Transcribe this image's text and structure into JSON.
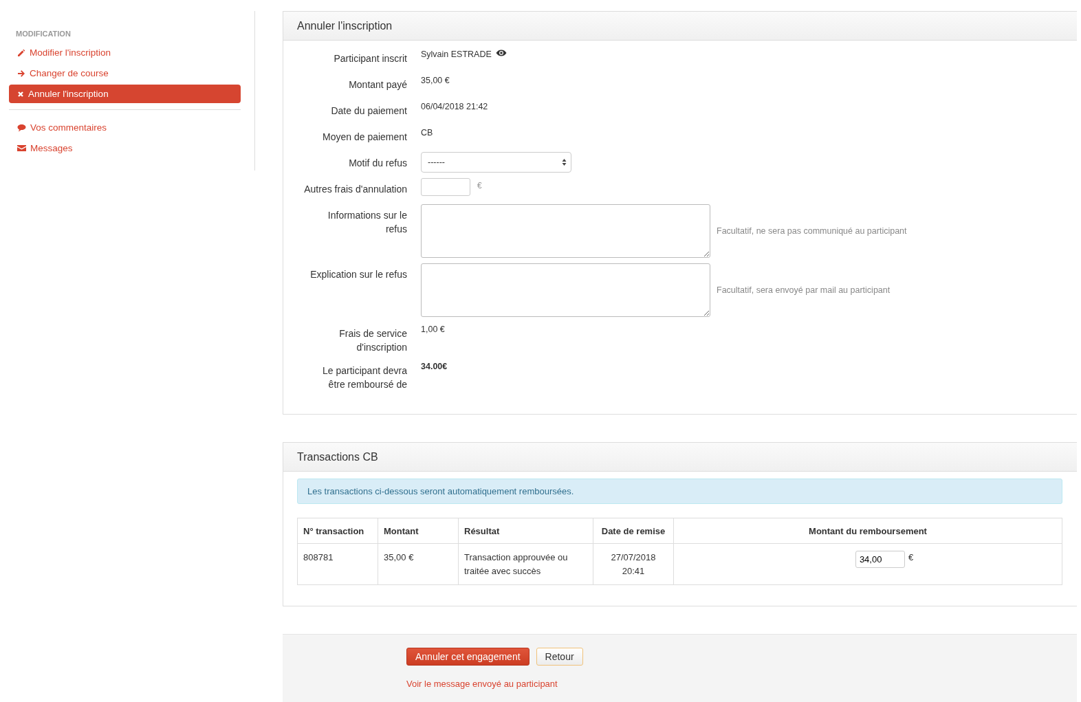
{
  "sidebar": {
    "heading": "MODIFICATION",
    "sections": [
      {
        "items": [
          {
            "kind": "pencil",
            "label": "Modifier l'inscription",
            "selected": false
          },
          {
            "kind": "arrow",
            "label": "Changer de course",
            "selected": false
          },
          {
            "kind": "cross",
            "label": "Annuler l'inscription",
            "selected": true
          }
        ]
      },
      {
        "items": [
          {
            "kind": "comment",
            "label": "Vos commentaires",
            "selected": false
          },
          {
            "kind": "envelope",
            "label": "Messages",
            "selected": false
          }
        ]
      }
    ]
  },
  "cancel_panel": {
    "title": "Annuler l'inscription",
    "fields": [
      {
        "kind": "person",
        "label": "Participant inscrit",
        "value": "Sylvain ESTRADE"
      },
      {
        "kind": "text",
        "label": "Montant payé",
        "value": "35,00 €"
      },
      {
        "kind": "text",
        "label": "Date du paiement",
        "value": "06/04/2018 21:42"
      },
      {
        "kind": "text",
        "label": "Moyen de paiement",
        "value": "CB"
      },
      {
        "kind": "select",
        "label": "Motif du refus",
        "value": "------"
      },
      {
        "kind": "amount",
        "label": "Autres frais d'annulation",
        "unit": "€"
      },
      {
        "kind": "textarea",
        "label": "Informations sur le refus",
        "help": "Facultatif, ne sera pas communiqué au participant"
      },
      {
        "kind": "textarea",
        "label": "Explication sur le refus",
        "help": "Facultatif, sera envoyé par mail au participant"
      },
      {
        "kind": "text",
        "label": "Frais de service d'inscription",
        "value": "1,00 €"
      },
      {
        "kind": "bold",
        "label": "Le participant devra être remboursé de",
        "value": "34.00€"
      }
    ]
  },
  "transactions_panel": {
    "title": "Transactions CB",
    "notice": "Les transactions ci-dessous seront automatiquement remboursées.",
    "table": {
      "columns": [
        "N° transaction",
        "Montant",
        "Résultat",
        "Date de remise",
        "Montant du remboursement"
      ],
      "rows": [
        {
          "transaction": "808781",
          "amount": "35,00 €",
          "result": "Transaction approuvée ou traitée avec succès",
          "date": "27/07/2018 20:41",
          "refund": "34,00",
          "currency": "€"
        }
      ]
    }
  },
  "actions": {
    "buttons": [
      {
        "kind": "primary",
        "label": "Annuler cet engagement"
      },
      {
        "kind": "secondary",
        "label": "Retour"
      }
    ],
    "link": "Voir le message envoyé au participant"
  }
}
